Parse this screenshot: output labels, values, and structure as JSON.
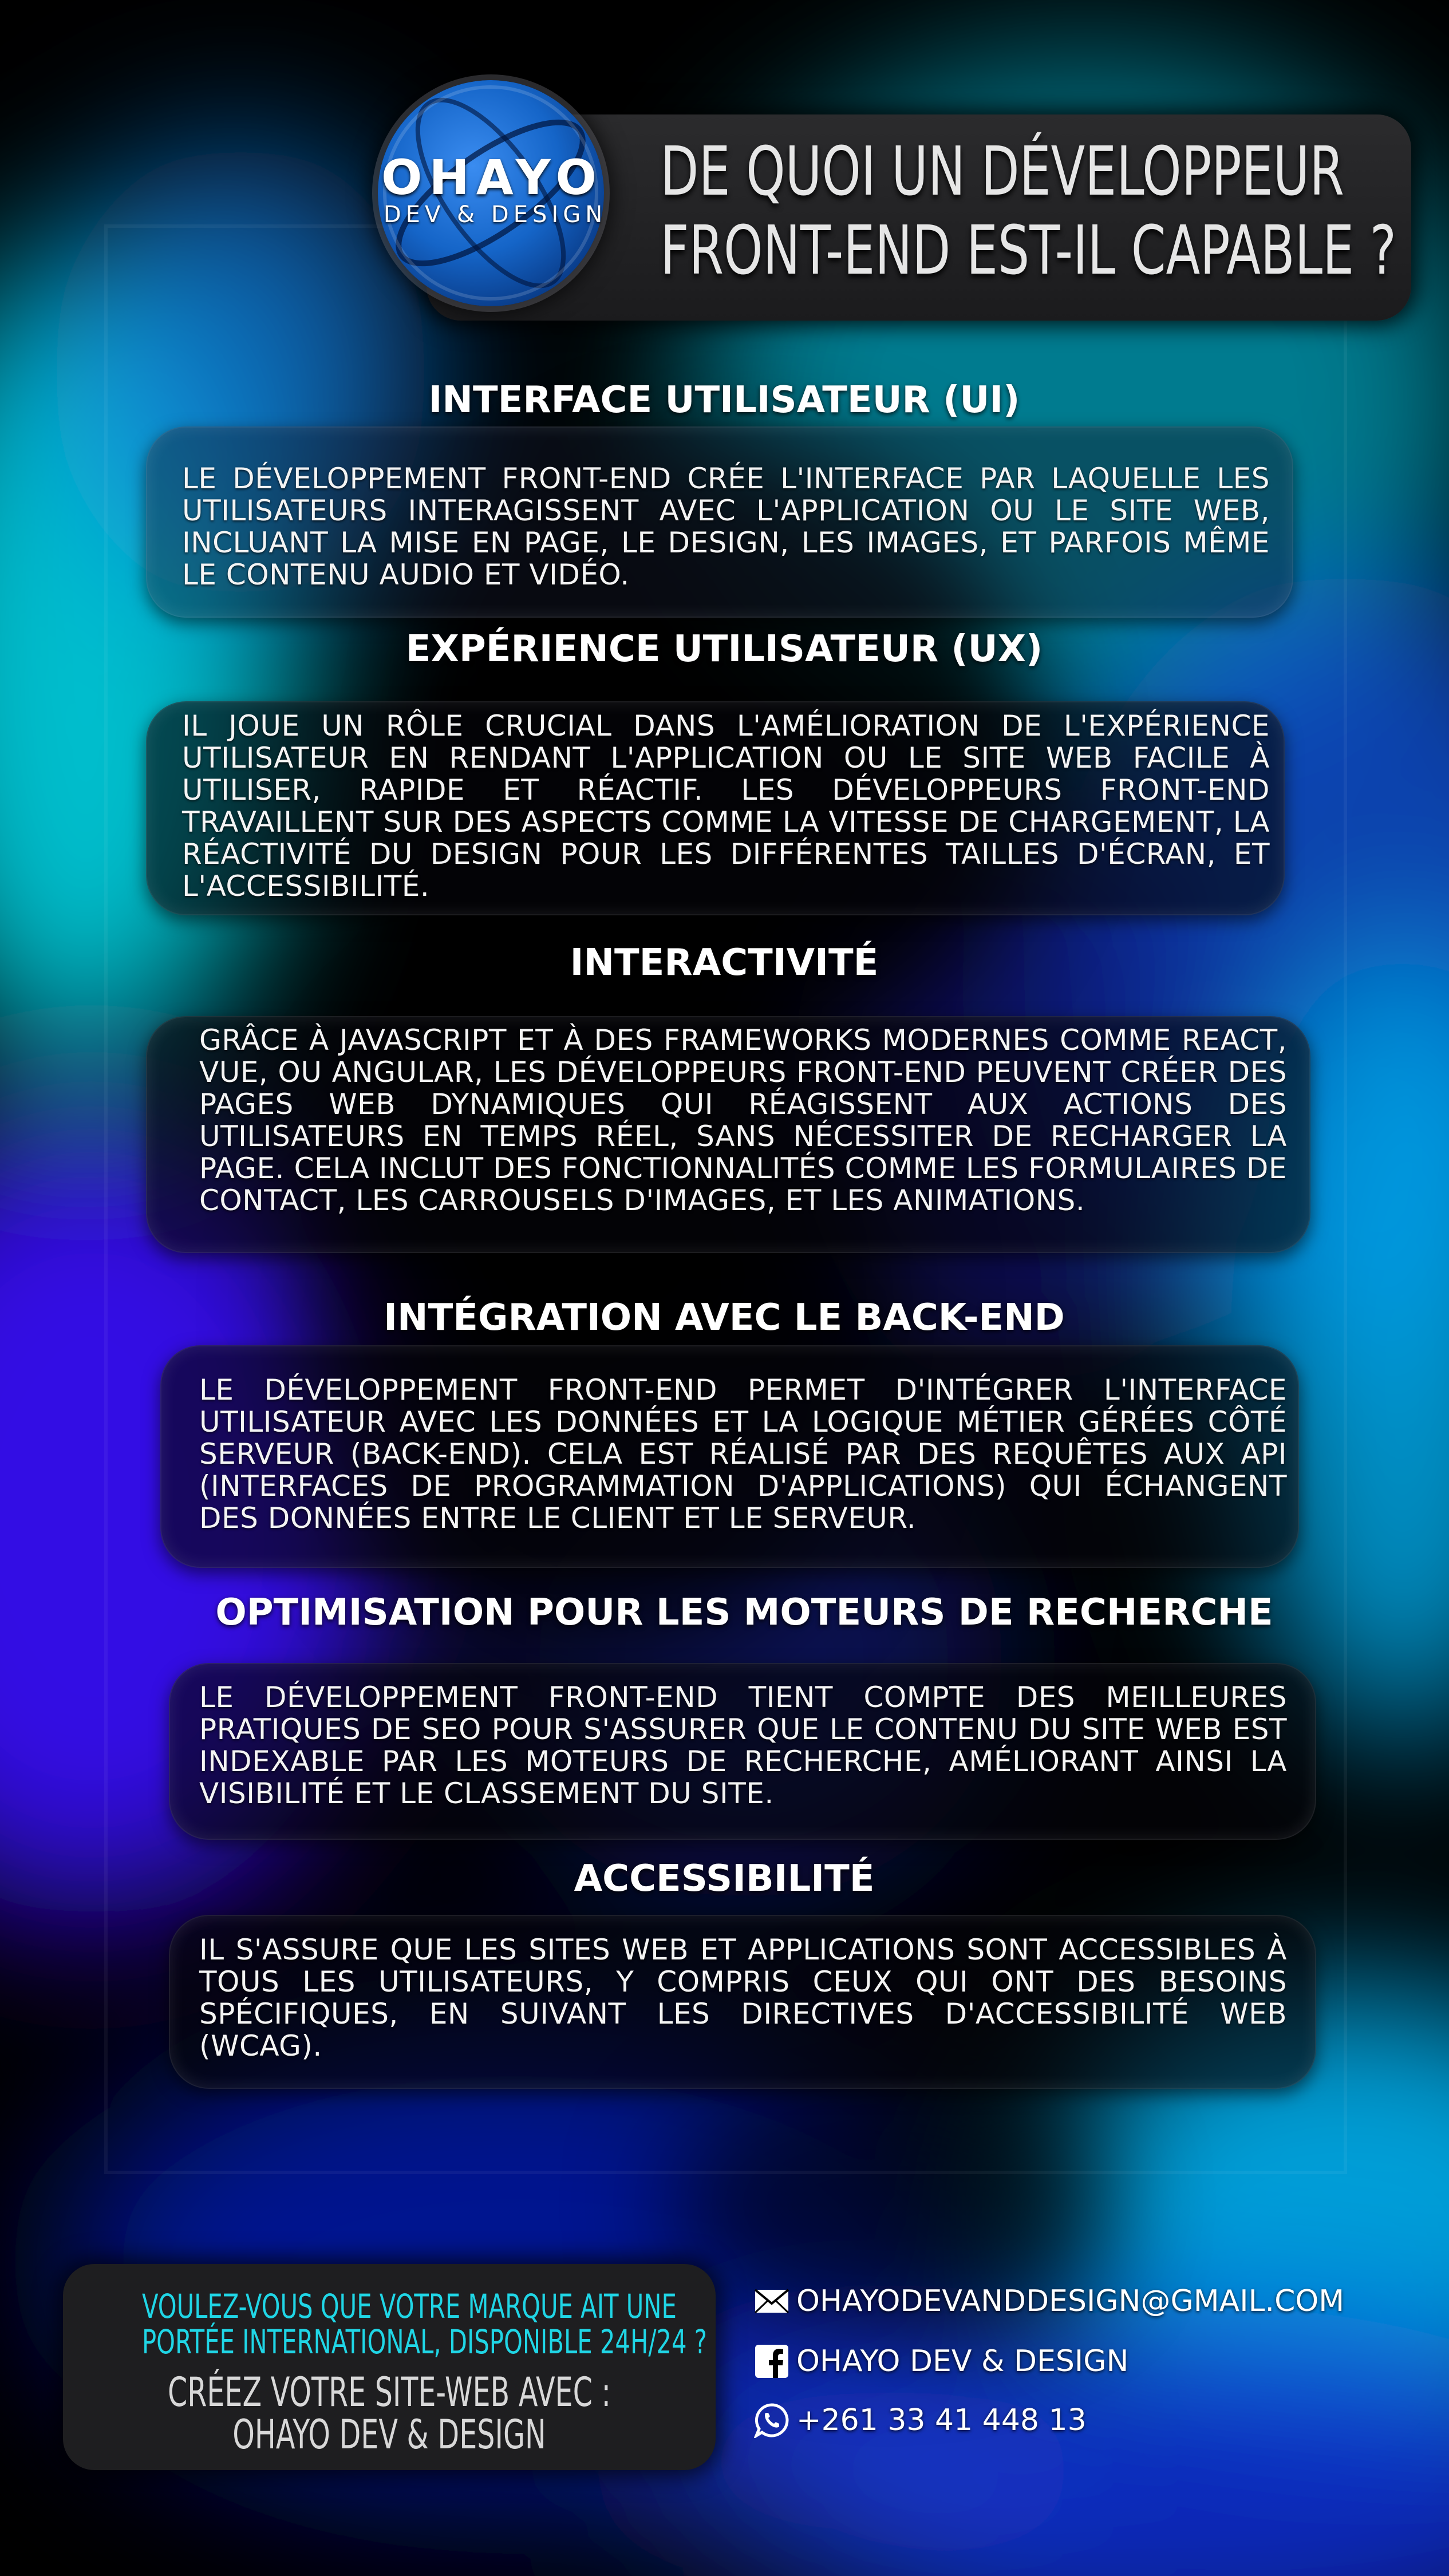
{
  "brand": {
    "logo_name": "OHAYO",
    "logo_tagline": "DEV & DESIGN"
  },
  "header": {
    "title_line1": "DE QUOI UN DÉVELOPPEUR",
    "title_line2": "FRONT-END EST-IL CAPABLE ?"
  },
  "sections": [
    {
      "title": "INTERFACE UTILISATEUR (UI)",
      "text": "LE DÉVELOPPEMENT FRONT-END CRÉE L'INTERFACE PAR LAQUELLE LES UTILISATEURS INTERAGISSENT AVEC L'APPLICATION OU LE SITE WEB, INCLUANT LA MISE EN PAGE, LE DESIGN, LES IMAGES, ET PARFOIS MÊME LE CONTENU AUDIO ET VIDÉO."
    },
    {
      "title": "EXPÉRIENCE UTILISATEUR (UX)",
      "text": "IL JOUE UN RÔLE CRUCIAL DANS L'AMÉLIORATION DE L'EXPÉRIENCE UTILISATEUR EN RENDANT L'APPLICATION OU LE SITE WEB FACILE À UTILISER, RAPIDE ET RÉACTIF. LES DÉVELOPPEURS FRONT-END TRAVAILLENT SUR DES ASPECTS COMME LA VITESSE DE CHARGEMENT, LA RÉACTIVITÉ DU DESIGN POUR LES DIFFÉRENTES TAILLES D'ÉCRAN, ET L'ACCESSIBILITÉ."
    },
    {
      "title": "INTERACTIVITÉ",
      "text": "GRÂCE À JAVASCRIPT ET À DES FRAMEWORKS MODERNES COMME REACT, VUE, OU ANGULAR, LES DÉVELOPPEURS FRONT-END PEUVENT CRÉER DES PAGES WEB DYNAMIQUES QUI RÉAGISSENT AUX ACTIONS DES UTILISATEURS EN TEMPS RÉEL, SANS NÉCESSITER DE RECHARGER LA PAGE. CELA INCLUT DES FONCTIONNALITÉS COMME LES FORMULAIRES DE CONTACT, LES CARROUSELS D'IMAGES, ET LES ANIMATIONS."
    },
    {
      "title": "INTÉGRATION AVEC LE BACK-END",
      "text": "LE DÉVELOPPEMENT FRONT-END PERMET D'INTÉGRER L'INTERFACE UTILISATEUR AVEC LES DONNÉES ET LA LOGIQUE MÉTIER GÉRÉES CÔTÉ SERVEUR (BACK-END). CELA EST RÉALISÉ PAR DES REQUÊTES AUX API (INTERFACES DE PROGRAMMATION D'APPLICATIONS) QUI ÉCHANGENT DES DONNÉES ENTRE LE CLIENT ET LE SERVEUR."
    },
    {
      "title": "OPTIMISATION POUR LES MOTEURS DE RECHERCHE",
      "text": "LE DÉVELOPPEMENT FRONT-END TIENT COMPTE DES MEILLEURES PRATIQUES DE SEO POUR S'ASSURER QUE LE CONTENU DU SITE WEB EST INDEXABLE PAR LES MOTEURS DE RECHERCHE, AMÉLIORANT AINSI LA VISIBILITÉ ET LE CLASSEMENT DU SITE."
    },
    {
      "title": "ACCESSIBILITÉ",
      "text": "IL S'ASSURE QUE LES SITES WEB ET APPLICATIONS SONT ACCESSIBLES À TOUS LES UTILISATEURS, Y COMPRIS CEUX QUI ONT DES BESOINS SPÉCIFIQUES, EN SUIVANT LES DIRECTIVES D'ACCESSIBILITÉ WEB (WCAG)."
    }
  ],
  "cta": {
    "question_line1": "VOULEZ-VOUS QUE VOTRE MARQUE AIT UNE",
    "question_line2": "PORTÉE INTERNATIONAL, DISPONIBLE 24H/24 ?",
    "action_line1": "CRÉEZ VOTRE SITE-WEB AVEC :",
    "action_line2": "OHAYO DEV & DESIGN"
  },
  "contacts": {
    "email": "OHAYODEVANDDESIGN@GMAIL.COM",
    "facebook": "OHAYO DEV & DESIGN",
    "whatsapp": "+261 33 41 448 13",
    "icons": [
      "mail-icon",
      "facebook-icon",
      "whatsapp-icon"
    ]
  },
  "colors": {
    "cta_question": "#20d6e6",
    "cta_action": "#d8d8d8",
    "panel": "#1e1e20",
    "accent_cyan": "#00e5ff",
    "accent_violet": "#3a10ff"
  }
}
